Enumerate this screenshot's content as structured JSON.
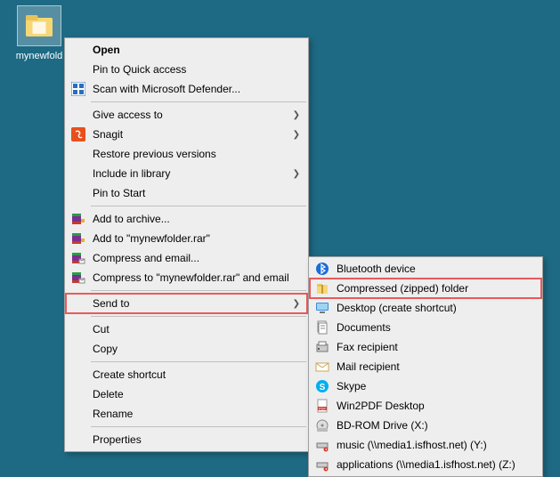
{
  "desktop": {
    "folder_label": "mynewfold"
  },
  "main_menu": [
    {
      "label": "Open",
      "bold": true
    },
    {
      "label": "Pin to Quick access"
    },
    {
      "icon": "defender",
      "label": "Scan with Microsoft Defender..."
    },
    {
      "sep": true
    },
    {
      "label": "Give access to",
      "submenu": true
    },
    {
      "icon": "snagit",
      "label": "Snagit",
      "submenu": true
    },
    {
      "label": "Restore previous versions"
    },
    {
      "label": "Include in library",
      "submenu": true
    },
    {
      "label": "Pin to Start"
    },
    {
      "sep": true
    },
    {
      "icon": "rar-add",
      "label": "Add to archive..."
    },
    {
      "icon": "rar-add",
      "label": "Add to \"mynewfolder.rar\""
    },
    {
      "icon": "rar-mail",
      "label": "Compress and email..."
    },
    {
      "icon": "rar-mail",
      "label": "Compress to \"mynewfolder.rar\" and email"
    },
    {
      "sep": true
    },
    {
      "label": "Send to",
      "submenu": true,
      "highlight": true
    },
    {
      "sep": true
    },
    {
      "label": "Cut"
    },
    {
      "label": "Copy"
    },
    {
      "sep": true
    },
    {
      "label": "Create shortcut"
    },
    {
      "label": "Delete"
    },
    {
      "label": "Rename"
    },
    {
      "sep": true
    },
    {
      "label": "Properties"
    }
  ],
  "sub_menu": [
    {
      "icon": "bluetooth",
      "label": "Bluetooth device"
    },
    {
      "icon": "zip",
      "label": "Compressed (zipped) folder",
      "highlight": true
    },
    {
      "icon": "desktop",
      "label": "Desktop (create shortcut)"
    },
    {
      "icon": "documents",
      "label": "Documents"
    },
    {
      "icon": "fax",
      "label": "Fax recipient"
    },
    {
      "icon": "mail",
      "label": "Mail recipient"
    },
    {
      "icon": "skype",
      "label": "Skype"
    },
    {
      "icon": "win2pdf",
      "label": "Win2PDF Desktop"
    },
    {
      "icon": "bd",
      "label": "BD-ROM Drive (X:)"
    },
    {
      "icon": "netdrive",
      "label": "music (\\\\media1.isfhost.net) (Y:)"
    },
    {
      "icon": "netdrive",
      "label": "applications (\\\\media1.isfhost.net) (Z:)"
    }
  ]
}
